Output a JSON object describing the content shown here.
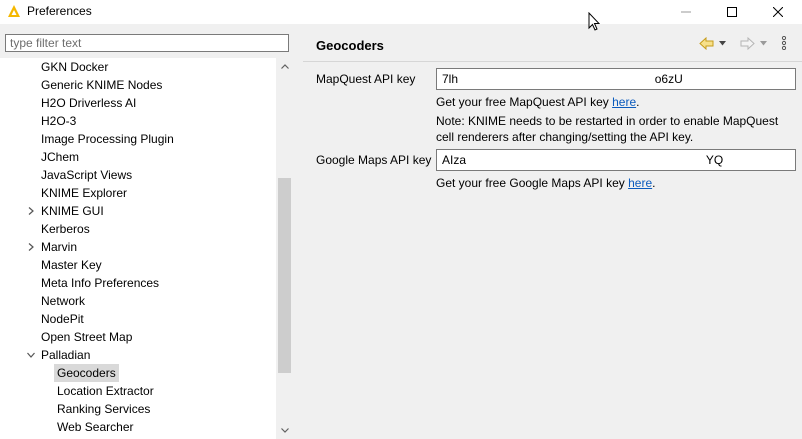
{
  "window": {
    "title": "Preferences",
    "controls": {
      "minimize": "—",
      "maximize": "☐",
      "close": "✕"
    }
  },
  "sidebar": {
    "filter_placeholder": "type filter text",
    "items": [
      {
        "label": "GKN Docker",
        "expandable": false
      },
      {
        "label": "Generic KNIME Nodes",
        "expandable": false
      },
      {
        "label": "H2O Driverless AI",
        "expandable": false
      },
      {
        "label": "H2O-3",
        "expandable": false
      },
      {
        "label": "Image Processing Plugin",
        "expandable": false
      },
      {
        "label": "JChem",
        "expandable": false
      },
      {
        "label": "JavaScript Views",
        "expandable": false
      },
      {
        "label": "KNIME Explorer",
        "expandable": false
      },
      {
        "label": "KNIME GUI",
        "expandable": true,
        "expanded": false
      },
      {
        "label": "Kerberos",
        "expandable": false
      },
      {
        "label": "Marvin",
        "expandable": true,
        "expanded": false
      },
      {
        "label": "Master Key",
        "expandable": false
      },
      {
        "label": "Meta Info Preferences",
        "expandable": false
      },
      {
        "label": "Network",
        "expandable": false
      },
      {
        "label": "NodePit",
        "expandable": false
      },
      {
        "label": "Open Street Map",
        "expandable": false
      },
      {
        "label": "Palladian",
        "expandable": true,
        "expanded": true
      },
      {
        "label": "Geocoders",
        "child": true,
        "selected": true
      },
      {
        "label": "Location Extractor",
        "child": true
      },
      {
        "label": "Ranking Services",
        "child": true
      },
      {
        "label": "Web Searcher",
        "child": true
      }
    ]
  },
  "main": {
    "title": "Geocoders",
    "mapquest": {
      "label": "MapQuest API key",
      "value": "7lh                                                           o6zU",
      "help_prefix": "Get your free MapQuest API key ",
      "help_link": "here",
      "help_suffix": ".",
      "note": "Note: KNIME needs to be restarted in order to enable MapQuest cell renderers after changing/setting the API key."
    },
    "google": {
      "label": "Google Maps API key",
      "value": "AIza                                                                        YQ",
      "help_prefix": "Get your free Google Maps API key ",
      "help_link": "here",
      "help_suffix": "."
    }
  },
  "colors": {
    "accent_yellow": "#f5b800",
    "link": "#0b5bbd",
    "selection": "#d9d9d9"
  }
}
